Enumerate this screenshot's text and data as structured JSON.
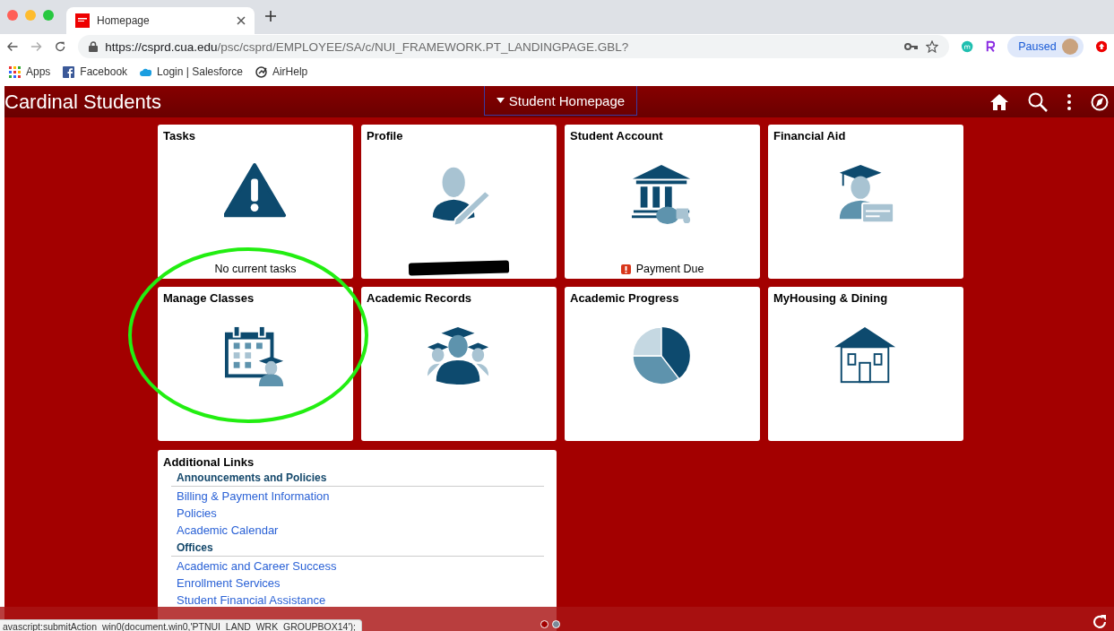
{
  "browser": {
    "tabs": [
      {
        "title": "Homepage",
        "selected": true
      }
    ],
    "url_host": "https://csprd.cua.edu",
    "url_path": "/psc/csprd/EMPLOYEE/SA/c/NUI_FRAMEWORK.PT_LANDINGPAGE.GBL?",
    "bookmarks": [
      {
        "label": "Apps"
      },
      {
        "label": "Facebook"
      },
      {
        "label": "Login | Salesforce"
      },
      {
        "label": "AirHelp"
      }
    ],
    "profile_status": "Paused"
  },
  "app": {
    "title": "Cardinal Students",
    "page_menu": "Student Homepage"
  },
  "tiles": [
    {
      "title": "Tasks",
      "footer": "No current tasks",
      "alert": false
    },
    {
      "title": "Profile",
      "redacted": true
    },
    {
      "title": "Student Account",
      "footer": "Payment Due",
      "alert": true
    },
    {
      "title": "Financial Aid"
    },
    {
      "title": "Manage Classes"
    },
    {
      "title": "Academic Records"
    },
    {
      "title": "Academic Progress"
    },
    {
      "title": "MyHousing & Dining"
    }
  ],
  "additional_links": {
    "title": "Additional Links",
    "groups": [
      {
        "heading": "Announcements and Policies",
        "links": [
          "Billing & Payment Information",
          "Policies",
          "Academic Calendar"
        ]
      },
      {
        "heading": "Offices",
        "links": [
          "Academic and Career Success",
          "Enrollment Services",
          "Student Financial Assistance"
        ]
      }
    ]
  },
  "pager": [
    {
      "selected": true
    },
    {
      "selected": false
    }
  ],
  "status_url": "avascript:submitAction_win0(document.win0,'PTNUI_LAND_WRK_GROUPBOX14');"
}
